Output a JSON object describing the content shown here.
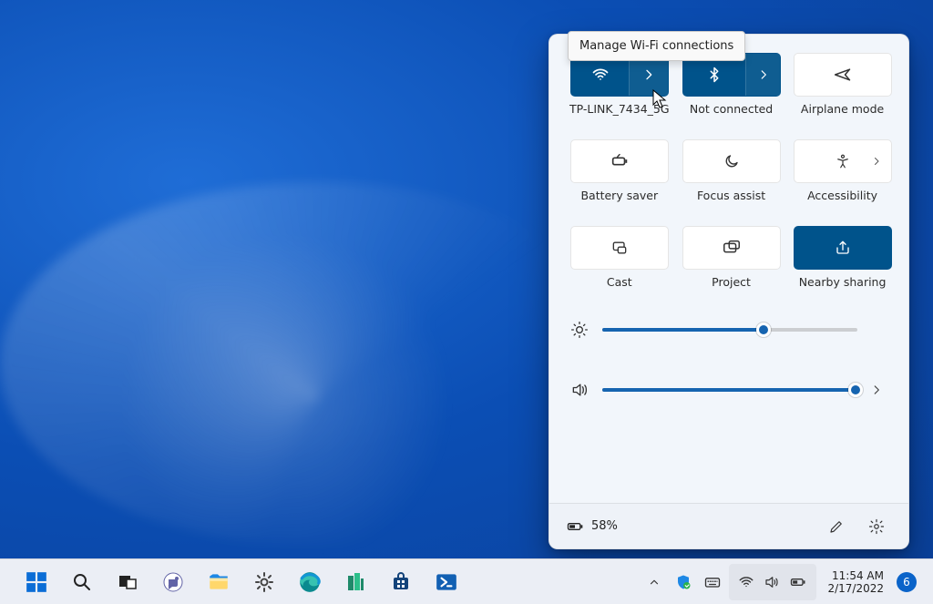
{
  "tooltip": "Manage Wi-Fi connections",
  "tiles": {
    "wifi": {
      "label": "TP-LINK_7434_5G"
    },
    "bluetooth": {
      "label": "Not connected"
    },
    "airplane": {
      "label": "Airplane mode"
    },
    "battery_saver": {
      "label": "Battery saver"
    },
    "focus_assist": {
      "label": "Focus assist"
    },
    "accessibility": {
      "label": "Accessibility"
    },
    "cast": {
      "label": "Cast"
    },
    "project": {
      "label": "Project"
    },
    "nearby_sharing": {
      "label": "Nearby sharing"
    }
  },
  "sliders": {
    "brightness": {
      "percent": 64
    },
    "volume": {
      "percent": 100
    }
  },
  "footer": {
    "battery_percent": "58%"
  },
  "clock": {
    "time": "11:54 AM",
    "date": "2/17/2022"
  },
  "notifications": {
    "count": "6"
  },
  "colors": {
    "accent": "#00538b",
    "slider": "#1664b0"
  }
}
